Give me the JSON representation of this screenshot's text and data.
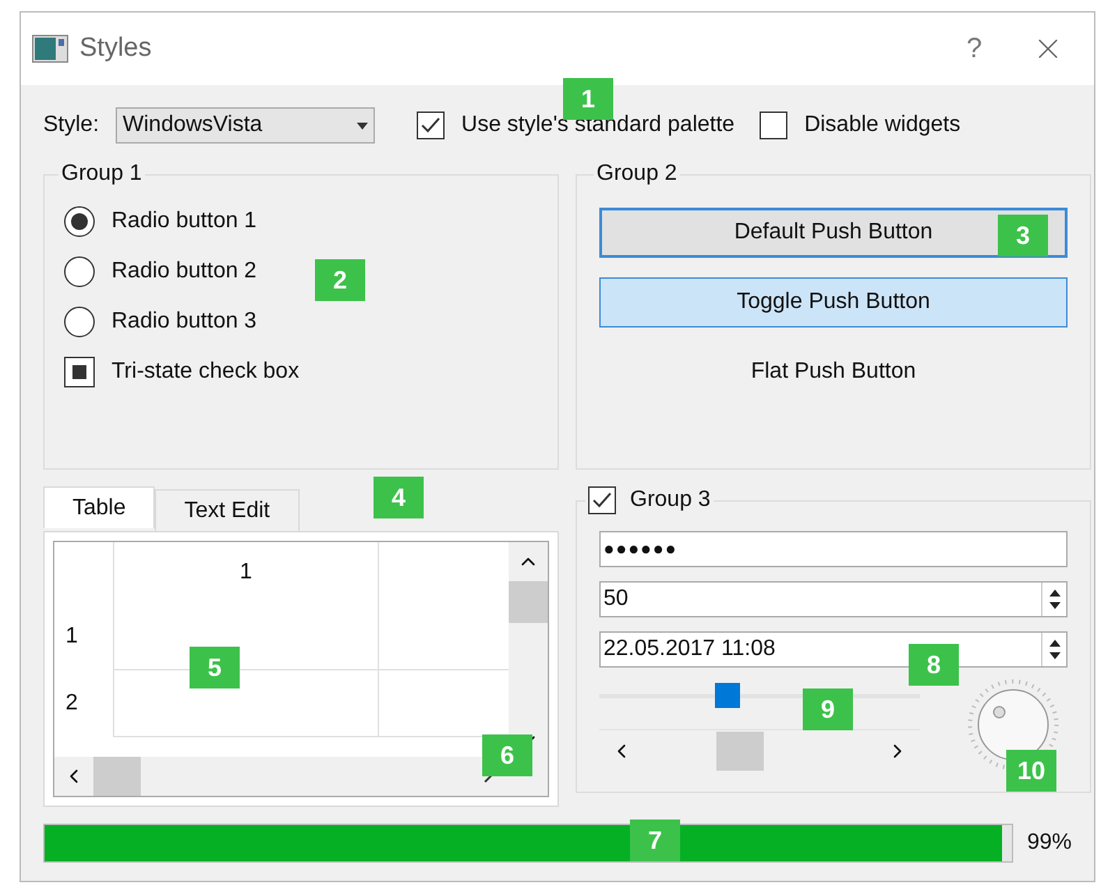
{
  "window": {
    "title": "Styles",
    "help": "?"
  },
  "style_selector": {
    "label": "Style:",
    "value": "WindowsVista"
  },
  "options": [
    {
      "label": "Use style's standard palette",
      "checked": true
    },
    {
      "label": "Disable widgets",
      "checked": false
    }
  ],
  "group1": {
    "title": "Group 1",
    "radios": [
      {
        "label": "Radio button 1",
        "selected": true
      },
      {
        "label": "Radio button 2",
        "selected": false
      },
      {
        "label": "Radio button 3",
        "selected": false
      }
    ],
    "tristate": {
      "label": "Tri-state check box",
      "partial": true
    }
  },
  "group2": {
    "title": "Group 2",
    "buttons": [
      {
        "label": "Default Push Button",
        "kind": "default"
      },
      {
        "label": "Toggle Push Button",
        "kind": "toggle",
        "on": true
      },
      {
        "label": "Flat Push Button",
        "kind": "flat"
      }
    ]
  },
  "tabs": [
    {
      "label": "Table",
      "selected": true
    },
    {
      "label": "Text Edit",
      "selected": false
    }
  ],
  "table": {
    "columns": [
      "1"
    ],
    "rows": [
      "1",
      "2"
    ]
  },
  "group3": {
    "title": "Group 3",
    "checked": true,
    "password": "●●●●●●",
    "spin_value": "50",
    "datetime": "22.05.2017 11:08",
    "slider": {
      "level": 0.4
    }
  },
  "progress": {
    "level": 0.99,
    "reading": "99%"
  },
  "callouts": [
    "1",
    "2",
    "3",
    "4",
    "5",
    "6",
    "7",
    "8",
    "9",
    "10"
  ]
}
